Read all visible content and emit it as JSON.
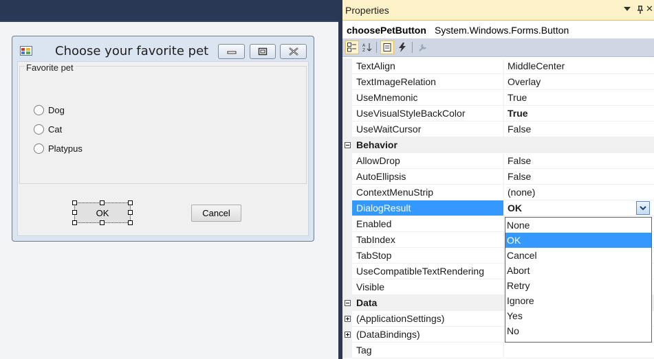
{
  "form": {
    "title": "Choose your favorite pet",
    "group_label": "Favorite pet",
    "radios": [
      "Dog",
      "Cat",
      "Platypus"
    ],
    "ok_label": "OK",
    "cancel_label": "Cancel"
  },
  "properties": {
    "title": "Properties",
    "object_name": "choosePetButton",
    "object_type": "System.Windows.Forms.Button",
    "rows": [
      {
        "kind": "prop",
        "name": "TextAlign",
        "value": "MiddleCenter"
      },
      {
        "kind": "prop",
        "name": "TextImageRelation",
        "value": "Overlay"
      },
      {
        "kind": "prop",
        "name": "UseMnemonic",
        "value": "True"
      },
      {
        "kind": "prop",
        "name": "UseVisualStyleBackColor",
        "value": "True",
        "bold": true
      },
      {
        "kind": "prop",
        "name": "UseWaitCursor",
        "value": "False"
      },
      {
        "kind": "category",
        "name": "Behavior"
      },
      {
        "kind": "prop",
        "name": "AllowDrop",
        "value": "False"
      },
      {
        "kind": "prop",
        "name": "AutoEllipsis",
        "value": "False"
      },
      {
        "kind": "prop",
        "name": "ContextMenuStrip",
        "value": "(none)"
      },
      {
        "kind": "prop",
        "name": "DialogResult",
        "value": "OK",
        "bold": true,
        "selected": true
      },
      {
        "kind": "prop",
        "name": "Enabled",
        "value": ""
      },
      {
        "kind": "prop",
        "name": "TabIndex",
        "value": ""
      },
      {
        "kind": "prop",
        "name": "TabStop",
        "value": ""
      },
      {
        "kind": "prop",
        "name": "UseCompatibleTextRendering",
        "value": ""
      },
      {
        "kind": "prop",
        "name": "Visible",
        "value": ""
      },
      {
        "kind": "category",
        "name": "Data"
      },
      {
        "kind": "prop",
        "name": "(ApplicationSettings)",
        "value": "",
        "expandable": true
      },
      {
        "kind": "prop",
        "name": "(DataBindings)",
        "value": "",
        "expandable": true
      },
      {
        "kind": "prop",
        "name": "Tag",
        "value": ""
      }
    ],
    "dropdown_options": [
      "None",
      "OK",
      "Cancel",
      "Abort",
      "Retry",
      "Ignore",
      "Yes",
      "No"
    ],
    "dropdown_selected": "OK"
  },
  "colors": {
    "selection": "#3399ff",
    "ide_frame": "#293955",
    "tool_header": "#fdf2c8"
  }
}
